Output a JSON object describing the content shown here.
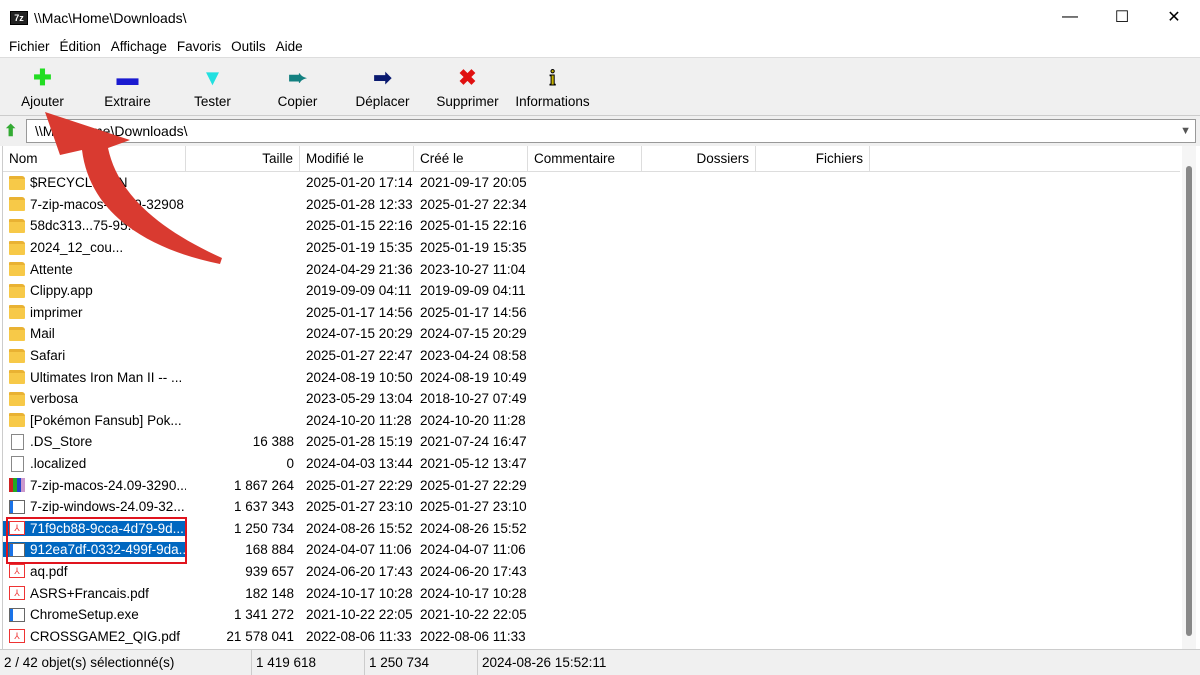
{
  "window": {
    "title": "\\\\Mac\\Home\\Downloads\\",
    "app_icon": "7z"
  },
  "menu": [
    "Fichier",
    "Édition",
    "Affichage",
    "Favoris",
    "Outils",
    "Aide"
  ],
  "toolbar": [
    {
      "label": "Ajouter",
      "icon": "plus-icon",
      "glyph": "✚",
      "color": "#22dd22"
    },
    {
      "label": "Extraire",
      "icon": "minus-icon",
      "glyph": "▬",
      "color": "#1a1ad0"
    },
    {
      "label": "Tester",
      "icon": "check-icon",
      "glyph": "▼",
      "color": "#22e0e0"
    },
    {
      "label": "Copier",
      "icon": "copy-arrow-icon",
      "glyph": "➨",
      "color": "#138080"
    },
    {
      "label": "Déplacer",
      "icon": "move-arrow-icon",
      "glyph": "➡",
      "color": "#0a1a70"
    },
    {
      "label": "Supprimer",
      "icon": "delete-icon",
      "glyph": "✖",
      "color": "#e01010"
    },
    {
      "label": "Informations",
      "icon": "info-icon",
      "glyph": "i",
      "color": "#c8b400"
    }
  ],
  "address": "\\\\Mac\\Home\\Downloads\\",
  "columns": [
    "Nom",
    "Taille",
    "Modifié le",
    "Créé le",
    "Commentaire",
    "Dossiers",
    "Fichiers"
  ],
  "files": [
    {
      "name": "$RECYCLE.BIN",
      "type": "folder",
      "size": "",
      "modified": "2025-01-20 17:14",
      "created": "2021-09-17 20:05"
    },
    {
      "name": "7-zip-macos-24.09-32908",
      "type": "folder",
      "size": "",
      "modified": "2025-01-28 12:33",
      "created": "2025-01-27 22:34"
    },
    {
      "name": "58dc313...75-95...",
      "type": "folder",
      "size": "",
      "modified": "2025-01-15 22:16",
      "created": "2025-01-15 22:16"
    },
    {
      "name": "2024_12_cou...",
      "type": "folder",
      "size": "",
      "modified": "2025-01-19 15:35",
      "created": "2025-01-19 15:35"
    },
    {
      "name": "Attente",
      "type": "folder",
      "size": "",
      "modified": "2024-04-29 21:36",
      "created": "2023-10-27 11:04"
    },
    {
      "name": "Clippy.app",
      "type": "folder",
      "size": "",
      "modified": "2019-09-09 04:11",
      "created": "2019-09-09 04:11"
    },
    {
      "name": "imprimer",
      "type": "folder",
      "size": "",
      "modified": "2025-01-17 14:56",
      "created": "2025-01-17 14:56"
    },
    {
      "name": "Mail",
      "type": "folder",
      "size": "",
      "modified": "2024-07-15 20:29",
      "created": "2024-07-15 20:29"
    },
    {
      "name": "Safari",
      "type": "folder",
      "size": "",
      "modified": "2025-01-27 22:47",
      "created": "2023-04-24 08:58"
    },
    {
      "name": "Ultimates Iron Man II -- ...",
      "type": "folder",
      "size": "",
      "modified": "2024-08-19 10:50",
      "created": "2024-08-19 10:49"
    },
    {
      "name": "verbosa",
      "type": "folder",
      "size": "",
      "modified": "2023-05-29 13:04",
      "created": "2018-10-27 07:49"
    },
    {
      "name": "[Pokémon Fansub] Pok...",
      "type": "folder",
      "size": "",
      "modified": "2024-10-20 11:28",
      "created": "2024-10-20 11:28"
    },
    {
      "name": ".DS_Store",
      "type": "file",
      "size": "16 388",
      "modified": "2025-01-28 15:19",
      "created": "2021-07-24 16:47"
    },
    {
      "name": ".localized",
      "type": "file",
      "size": "0",
      "modified": "2024-04-03 13:44",
      "created": "2021-05-12 13:47"
    },
    {
      "name": "7-zip-macos-24.09-3290...",
      "type": "archive",
      "size": "1 867 264",
      "modified": "2025-01-27 22:29",
      "created": "2025-01-27 22:29"
    },
    {
      "name": "7-zip-windows-24.09-32...",
      "type": "exe",
      "size": "1 637 343",
      "modified": "2025-01-27 23:10",
      "created": "2025-01-27 23:10"
    },
    {
      "name": "71f9cb88-9cca-4d79-9d...",
      "type": "pdf",
      "size": "1 250 734",
      "modified": "2024-08-26 15:52",
      "created": "2024-08-26 15:52",
      "selected": true
    },
    {
      "name": "912ea7df-0332-499f-9da...",
      "type": "exe",
      "size": "168 884",
      "modified": "2024-04-07 11:06",
      "created": "2024-04-07 11:06",
      "selected": true
    },
    {
      "name": "aq.pdf",
      "type": "pdf",
      "size": "939 657",
      "modified": "2024-06-20 17:43",
      "created": "2024-06-20 17:43"
    },
    {
      "name": "ASRS+Francais.pdf",
      "type": "pdf",
      "size": "182 148",
      "modified": "2024-10-17 10:28",
      "created": "2024-10-17 10:28"
    },
    {
      "name": "ChromeSetup.exe",
      "type": "exe",
      "size": "1 341 272",
      "modified": "2021-10-22 22:05",
      "created": "2021-10-22 22:05"
    },
    {
      "name": "CROSSGAME2_QIG.pdf",
      "type": "pdf",
      "size": "21 578 041",
      "modified": "2022-08-06 11:33",
      "created": "2022-08-06 11:33"
    }
  ],
  "status": {
    "selection": "2 / 42 objet(s) sélectionné(s)",
    "total_size": "1 419 618",
    "focused_size": "1 250 734",
    "focused_date": "2024-08-26 15:52:11"
  },
  "annotation_color": "#d93a30"
}
